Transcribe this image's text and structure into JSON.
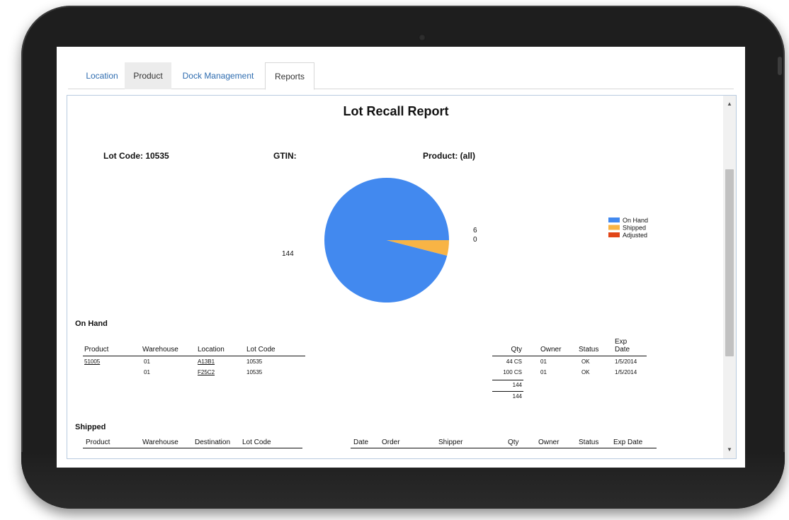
{
  "tabs": [
    {
      "label": "Location"
    },
    {
      "label": "Product"
    },
    {
      "label": "Dock Management"
    },
    {
      "label": "Reports"
    }
  ],
  "report": {
    "title": "Lot Recall Report",
    "lot_code_label": "Lot Code: 10535",
    "gtin_label": "GTIN:",
    "product_label": "Product: (all)"
  },
  "chart_data": {
    "type": "pie",
    "categories": [
      "On Hand",
      "Shipped",
      "Adjusted"
    ],
    "values": [
      144,
      6,
      0
    ],
    "labels": [
      "144",
      "6",
      "0"
    ],
    "colors": [
      "#4289ef",
      "#f8b445",
      "#e14517"
    ],
    "legend_position": "right"
  },
  "on_hand": {
    "title": "On Hand",
    "headers": {
      "product": "Product",
      "warehouse": "Warehouse",
      "location": "Location",
      "lot_code": "Lot Code",
      "qty": "Qty",
      "owner": "Owner",
      "status": "Status",
      "exp_date_1": "Exp",
      "exp_date_2": "Date"
    },
    "rows": [
      {
        "product": "51005",
        "warehouse": "01",
        "location": "A13B1",
        "lot_code": "10535",
        "qty": "44 CS",
        "owner": "01",
        "status": "OK",
        "exp_date": "1/5/2014"
      },
      {
        "product": "",
        "warehouse": "01",
        "location": "F25C2",
        "lot_code": "10535",
        "qty": "100 CS",
        "owner": "01",
        "status": "OK",
        "exp_date": "1/5/2014"
      }
    ],
    "subtotal": "144",
    "total": "144"
  },
  "shipped": {
    "title": "Shipped",
    "headers": {
      "product": "Product",
      "warehouse": "Warehouse",
      "destination": "Destination",
      "lot_code": "Lot Code",
      "date": "Date",
      "order": "Order",
      "shipper": "Shipper",
      "qty": "Qty",
      "owner": "Owner",
      "status": "Status",
      "exp_date": "Exp Date"
    }
  }
}
